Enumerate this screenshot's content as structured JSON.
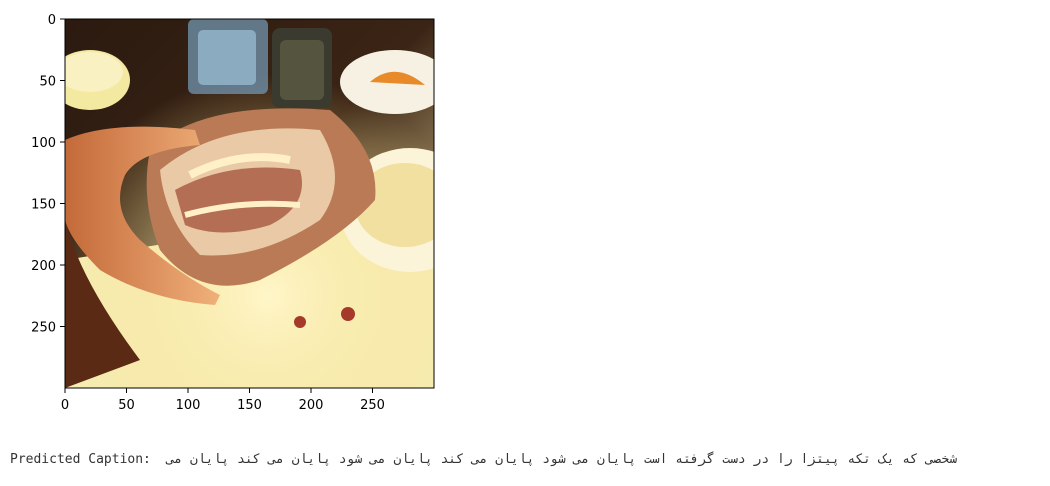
{
  "axes": {
    "x_ticks": [
      "0",
      "50",
      "100",
      "150",
      "200",
      "250"
    ],
    "y_ticks": [
      "0",
      "50",
      "100",
      "150",
      "200",
      "250"
    ]
  },
  "image": {
    "subject": "hand holding a reuben sandwich over a restaurant table"
  },
  "caption": {
    "label": "Predicted Caption:",
    "text": "شخصی که یک تکه پیتزا را در دست گرفته است پایان می شود پایان می کند پایان می شود پایان می کند پایان می"
  },
  "colors": {
    "axis": "#000000",
    "caption_text": "#333333",
    "background": "#ffffff"
  }
}
